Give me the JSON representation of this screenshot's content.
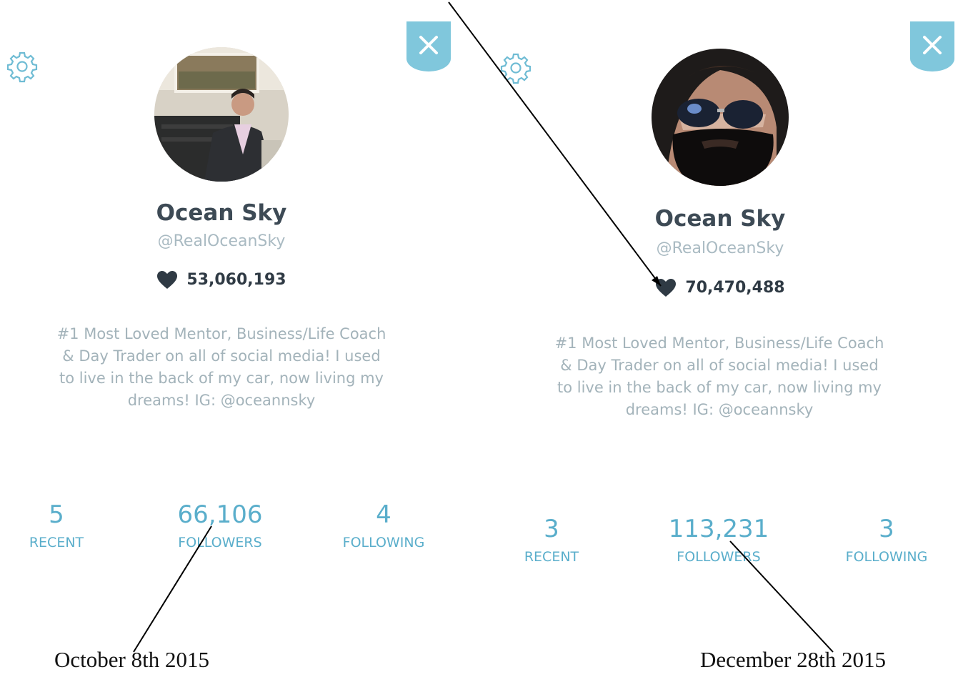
{
  "left_profile": {
    "name": "Ocean Sky",
    "handle": "@RealOceanSky",
    "likes": "53,060,193",
    "bio": "#1 Most Loved Mentor, Business/Life Coach & Day Trader on all of social media! I used to live in the back of my car, now living my dreams! IG: @oceannsky",
    "stats": [
      {
        "value": "5",
        "label": "RECENT"
      },
      {
        "value": "66,106",
        "label": "FOLLOWERS"
      },
      {
        "value": "4",
        "label": "FOLLOWING"
      }
    ],
    "date": "October 8th 2015"
  },
  "right_profile": {
    "name": "Ocean Sky",
    "handle": "@RealOceanSky",
    "likes": "70,470,488",
    "bio": "#1 Most Loved Mentor, Business/Life Coach & Day Trader on all of social media! I used to live in the back of my car, now living my dreams! IG: @oceannsky",
    "stats": [
      {
        "value": "3",
        "label": "RECENT"
      },
      {
        "value": "113,231",
        "label": "FOLLOWERS"
      },
      {
        "value": "3",
        "label": "FOLLOWING"
      }
    ],
    "date": "December 28th 2015"
  },
  "icons": {
    "settings": "gear-icon",
    "close": "close-icon",
    "likes": "heart-icon"
  },
  "colors": {
    "accent": "#5aaecb",
    "close_tab": "#80c7dc",
    "name": "#3d4a55",
    "muted": "#a3b3ba"
  }
}
